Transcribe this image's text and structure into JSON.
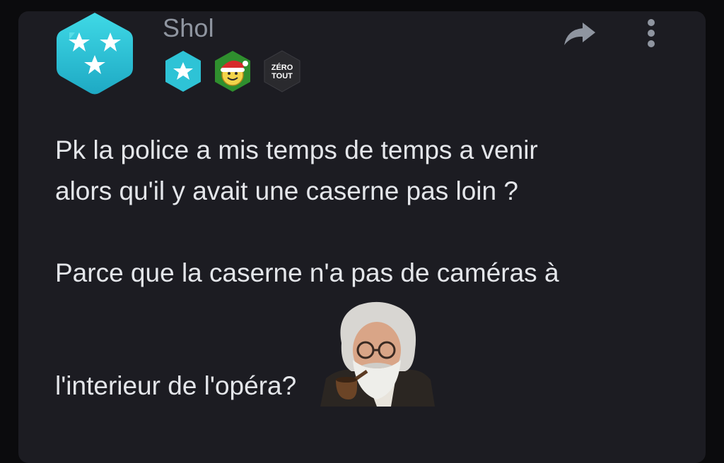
{
  "post": {
    "username": "Shol",
    "badges": [
      {
        "name": "star-level-badge-icon"
      },
      {
        "name": "santa-smiley-badge-icon"
      },
      {
        "name": "zero-tout-badge-icon",
        "text_line1": "ZÉRO",
        "text_line2": "TOUT"
      }
    ],
    "message": {
      "line1": "Pk la police a mis temps de temps a venir",
      "line2": "alors qu'il y avait une caserne pas loin ?",
      "line3": "Parce que la caserne n'a pas de caméras à",
      "line4": "l'interieur de l'opéra?"
    },
    "sticker": "old-man-with-pipe-sticker"
  },
  "colors": {
    "card_background": "#1c1c22",
    "page_background": "#0b0b0d",
    "text": "#e4e6ea",
    "username": "#8f95a0",
    "avatar_cyan": "#27c6d8"
  }
}
